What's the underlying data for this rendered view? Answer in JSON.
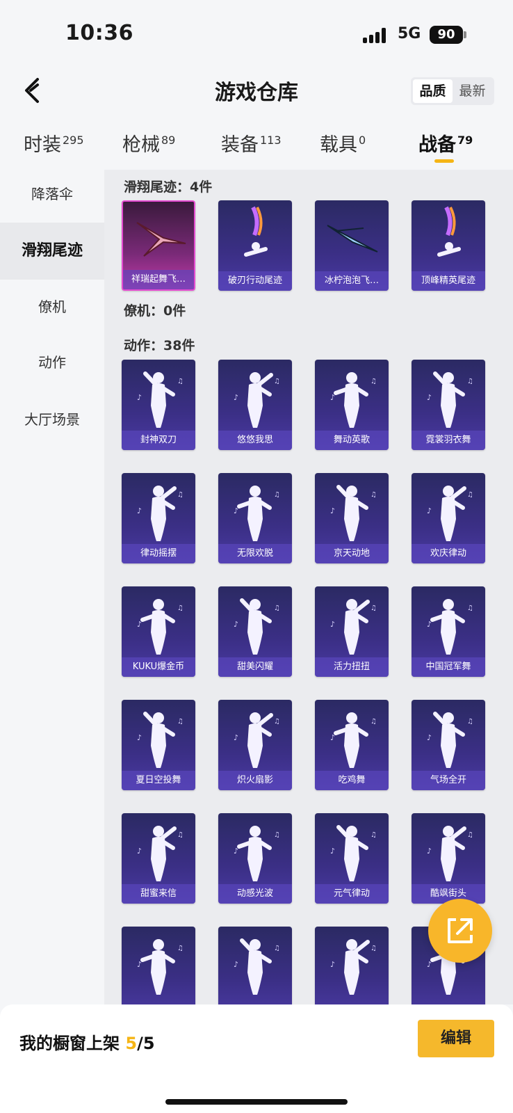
{
  "status": {
    "time": "10:36",
    "network": "5G",
    "battery": "90"
  },
  "header": {
    "title": "游戏仓库",
    "sort_options": [
      "品质",
      "最新"
    ]
  },
  "tabs": [
    {
      "label": "时装",
      "count": "295"
    },
    {
      "label": "枪械",
      "count": "89"
    },
    {
      "label": "装备",
      "count": "113"
    },
    {
      "label": "载具",
      "count": "0"
    },
    {
      "label": "战备",
      "count": "79"
    }
  ],
  "sidebar": [
    "降落伞",
    "滑翔尾迹",
    "僚机",
    "动作",
    "大厅场景"
  ],
  "sections": {
    "trails": "滑翔尾迹：4件",
    "wingman": "僚机：0件",
    "actions": "动作：38件"
  },
  "trail_items": [
    "祥瑞起舞飞…",
    "破刃行动尾迹",
    "冰柠泡泡飞…",
    "顶峰精英尾迹"
  ],
  "action_items": [
    "封神双刀",
    "悠悠我思",
    "舞动英歌",
    "霓裳羽衣舞",
    "律动摇摆",
    "无限欢脱",
    "京天动地",
    "欢庆律动",
    "KUKU爆金币",
    "甜美闪耀",
    "活力扭扭",
    "中国冠军舞",
    "夏日空投舞",
    "炽火扇影",
    "吃鸡舞",
    "气场全开",
    "甜蜜来信",
    "动感光波",
    "元气律动",
    "酷飒街头",
    "",
    "",
    "",
    ""
  ],
  "bottom": {
    "shelf_label": "我的橱窗上架",
    "shelf_count": "5",
    "shelf_total": "/5",
    "edit_label": "编辑"
  },
  "colors": {
    "accent": "#f5b516",
    "card_bg": "#3b2f86",
    "highlight_card": "#c23aa8"
  }
}
